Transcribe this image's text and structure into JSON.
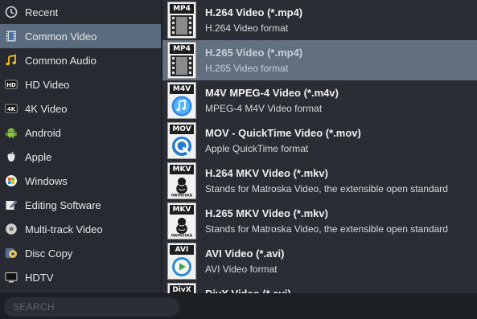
{
  "sidebar": {
    "items": [
      {
        "label": "Recent",
        "icon": "clock-icon",
        "selected": false
      },
      {
        "label": "Common Video",
        "icon": "film-icon",
        "selected": true
      },
      {
        "label": "Common Audio",
        "icon": "music-note-icon",
        "selected": false
      },
      {
        "label": "HD Video",
        "icon": "hd-icon",
        "selected": false
      },
      {
        "label": "4K Video",
        "icon": "4k-icon",
        "selected": false
      },
      {
        "label": "Android",
        "icon": "android-icon",
        "selected": false
      },
      {
        "label": "Apple",
        "icon": "apple-icon",
        "selected": false
      },
      {
        "label": "Windows",
        "icon": "windows-icon",
        "selected": false
      },
      {
        "label": "Editing Software",
        "icon": "edit-icon",
        "selected": false
      },
      {
        "label": "Multi-track Video",
        "icon": "multitrack-icon",
        "selected": false
      },
      {
        "label": "Disc Copy",
        "icon": "disc-icon",
        "selected": false
      },
      {
        "label": "HDTV",
        "icon": "tv-icon",
        "selected": false
      }
    ]
  },
  "formats": {
    "items": [
      {
        "tag": "MP4",
        "title": "H.264 Video (*.mp4)",
        "desc": "H.264 Video format",
        "icon": "film-strip-icon",
        "selected": false
      },
      {
        "tag": "MP4",
        "title": "H.265 Video (*.mp4)",
        "desc": "H.265 Video format",
        "icon": "film-strip-icon",
        "selected": true
      },
      {
        "tag": "M4V",
        "title": "M4V MPEG-4 Video (*.m4v)",
        "desc": "MPEG-4 M4V Video format",
        "icon": "itunes-icon",
        "selected": false
      },
      {
        "tag": "MOV",
        "title": "MOV - QuickTime Video (*.mov)",
        "desc": "Apple QuickTime format",
        "icon": "quicktime-icon",
        "selected": false
      },
      {
        "tag": "MKV",
        "title": "H.264 MKV Video (*.mkv)",
        "desc": "Stands for Matroska Video, the extensible open standard",
        "icon": "matroska-icon",
        "selected": false
      },
      {
        "tag": "MKV",
        "title": "H.265 MKV Video (*.mkv)",
        "desc": "Stands for Matroska Video, the extensible open standard",
        "icon": "matroska-icon",
        "selected": false
      },
      {
        "tag": "AVI",
        "title": "AVI Video (*.avi)",
        "desc": "AVI Video format",
        "icon": "avi-play-icon",
        "selected": false
      },
      {
        "tag": "DivX",
        "title": "DivX Video (*.avi)",
        "desc": "",
        "icon": "divx-icon",
        "selected": false
      }
    ]
  },
  "search": {
    "placeholder": "SEARCH",
    "value": ""
  },
  "colors": {
    "sidebar_bg": "#272b31",
    "list_bg": "#2a2e34",
    "selected_category": "#5a6b7d",
    "selected_format": "#616f7f"
  }
}
